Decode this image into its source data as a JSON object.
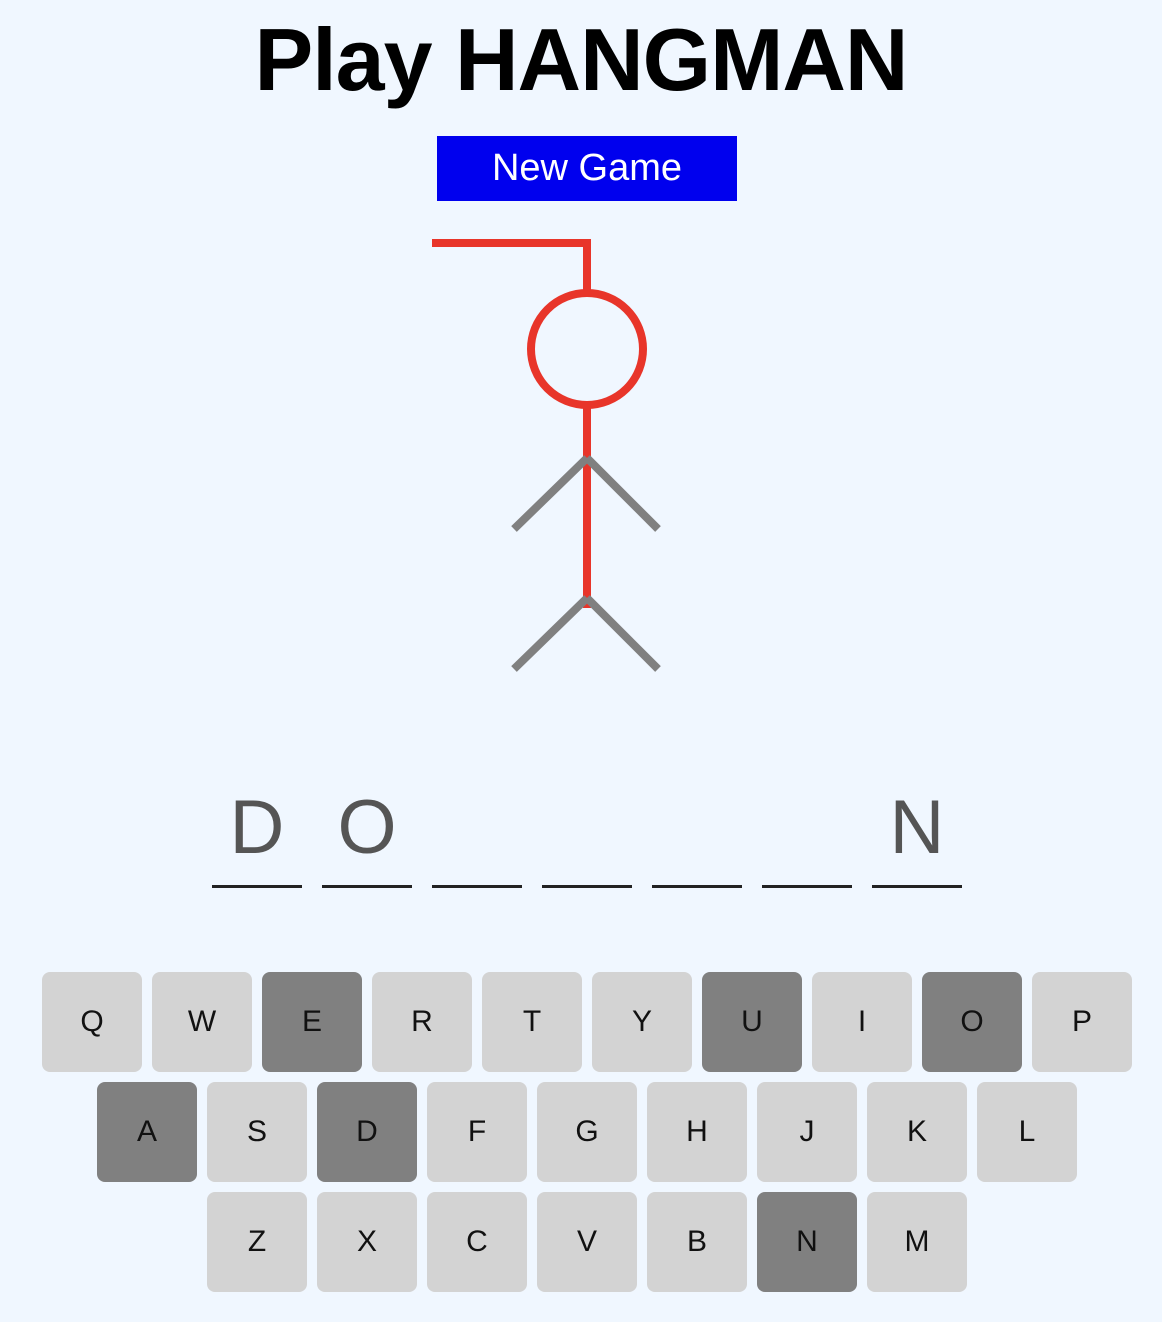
{
  "header": {
    "title": "Play HANGMAN"
  },
  "controls": {
    "new_game_label": "New Game"
  },
  "colors": {
    "background": "#f0f7ff",
    "button": "#0000ee",
    "gallows": "#e8352a",
    "limbs": "#808080",
    "key_default": "#d3d3d3",
    "key_used": "#808080"
  },
  "word": {
    "slots": [
      "D",
      "O",
      "",
      "",
      "",
      "",
      "N"
    ]
  },
  "keyboard": {
    "rows": [
      [
        {
          "letter": "Q",
          "used": false
        },
        {
          "letter": "W",
          "used": false
        },
        {
          "letter": "E",
          "used": true
        },
        {
          "letter": "R",
          "used": false
        },
        {
          "letter": "T",
          "used": false
        },
        {
          "letter": "Y",
          "used": false
        },
        {
          "letter": "U",
          "used": true
        },
        {
          "letter": "I",
          "used": false
        },
        {
          "letter": "O",
          "used": true
        },
        {
          "letter": "P",
          "used": false
        }
      ],
      [
        {
          "letter": "A",
          "used": true
        },
        {
          "letter": "S",
          "used": false
        },
        {
          "letter": "D",
          "used": true
        },
        {
          "letter": "F",
          "used": false
        },
        {
          "letter": "G",
          "used": false
        },
        {
          "letter": "H",
          "used": false
        },
        {
          "letter": "J",
          "used": false
        },
        {
          "letter": "K",
          "used": false
        },
        {
          "letter": "L",
          "used": false
        }
      ],
      [
        {
          "letter": "Z",
          "used": false
        },
        {
          "letter": "X",
          "used": false
        },
        {
          "letter": "C",
          "used": false
        },
        {
          "letter": "V",
          "used": false
        },
        {
          "letter": "B",
          "used": false
        },
        {
          "letter": "N",
          "used": true
        },
        {
          "letter": "M",
          "used": false
        }
      ]
    ]
  }
}
